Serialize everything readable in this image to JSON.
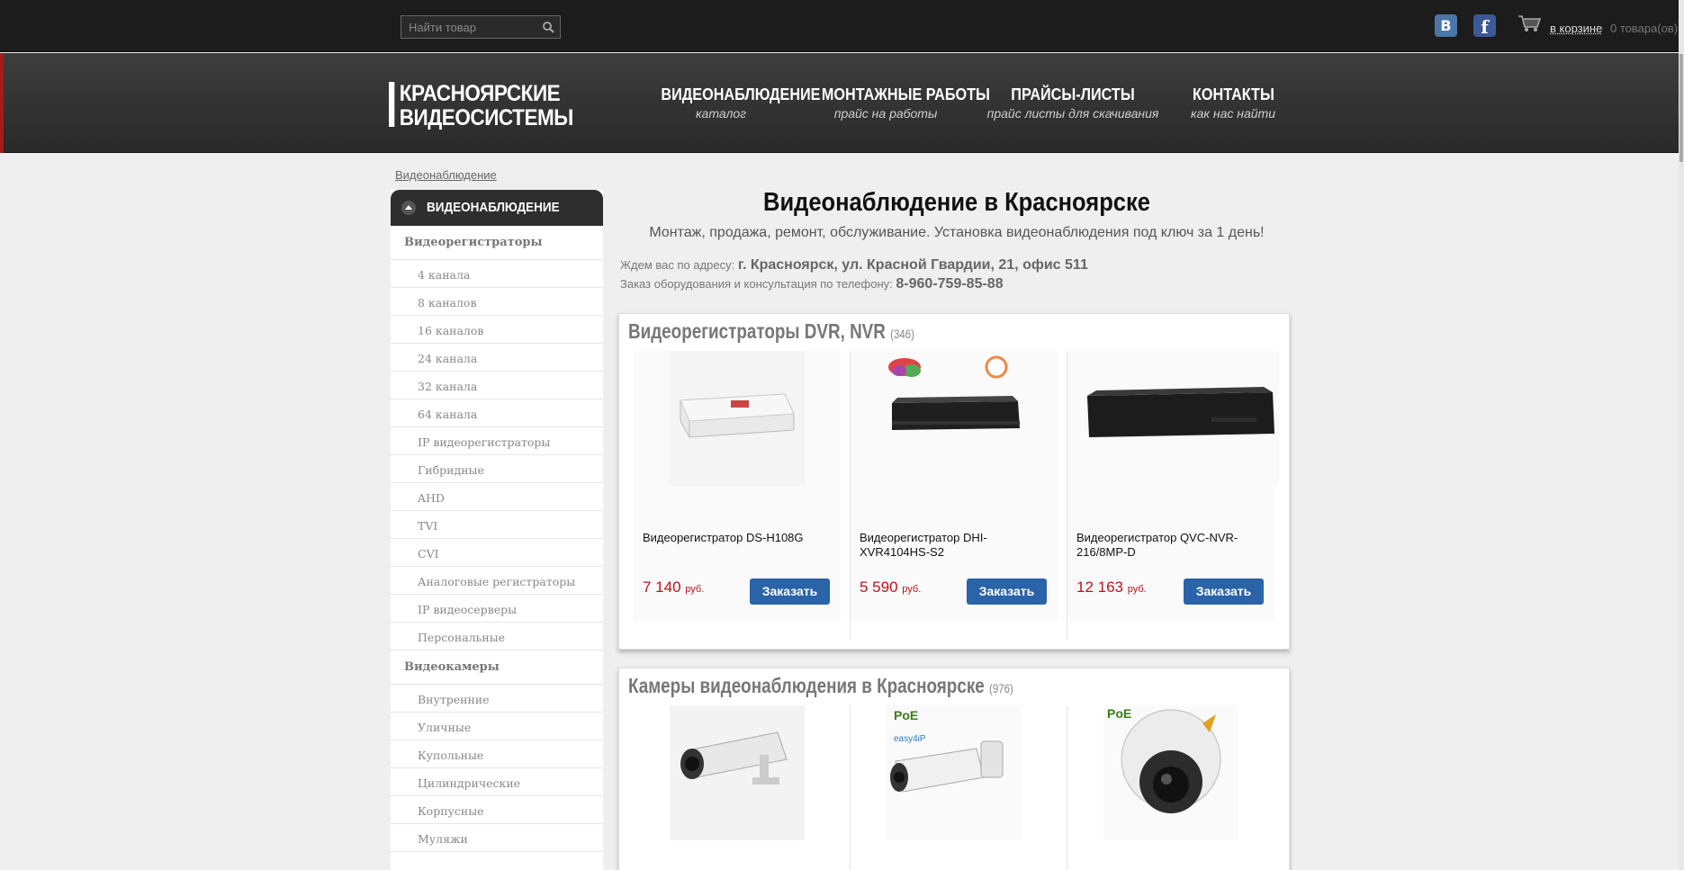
{
  "topbar": {
    "search_placeholder": "Найти товар",
    "social": [
      {
        "label": "B",
        "name": "vk-icon"
      },
      {
        "label": "f",
        "name": "facebook-icon"
      }
    ],
    "cart_link": "в корзине",
    "cart_count": "0 товара(ов)"
  },
  "header": {
    "logo_line1": "КРАСНОЯРСКИЕ",
    "logo_line2": "ВИДЕОСИСТЕМЫ",
    "nav": [
      {
        "title": "ВИДЕОНАБЛЮДЕНИЕ",
        "sub": "каталог"
      },
      {
        "title": "МОНТАЖНЫЕ РАБОТЫ",
        "sub": "прайс на работы"
      },
      {
        "title": "ПРАЙСЫ-ЛИСТЫ",
        "sub": "прайс листы для скачивания"
      },
      {
        "title": "КОНТАКТЫ",
        "sub": "как нас найти"
      }
    ]
  },
  "breadcrumb": "Видеонаблюдение",
  "sidebar": {
    "header": "ВИДЕОНАБЛЮДЕНИЕ",
    "group1": "Видеорегистраторы",
    "group1_items": [
      "4 канала",
      "8 каналов",
      "16 каналов",
      "24 канала",
      "32 канала",
      "64 канала",
      "IP видеорегистраторы",
      "Гибридные",
      "AHD",
      "TVI",
      "CVI",
      "Аналоговые регистраторы",
      "IP видеосерверы",
      "Персональные"
    ],
    "group2": "Видеокамеры",
    "group2_items": [
      "Внутренние",
      "Уличные",
      "Купольные",
      "Цилиндрические",
      "Корпусные",
      "Муляжи"
    ]
  },
  "main": {
    "title": "Видеонаблюдение в Красноярске",
    "subtitle": "Монтаж, продажа, ремонт, обслуживание. Установка видеонаблюдения под ключ за 1 день!",
    "address_label": "Ждем вас по адресу:",
    "address": "г. Красноярск, ул. Красной Гвардии, 21, офис 511",
    "phone_label": "Заказ оборудования и консультация по телефону:",
    "phone": "8-960-759-85-88"
  },
  "sections": [
    {
      "title": "Видеорегистраторы DVR, NVR",
      "count": "(346)",
      "products": [
        {
          "name": "Видеорегистратор DS-H108G",
          "price": "7 140",
          "currency": "руб.",
          "button": "Заказать"
        },
        {
          "name": "Видеорегистратор DHI-XVR4104HS-S2",
          "price": "5 590",
          "currency": "руб.",
          "button": "Заказать"
        },
        {
          "name": "Видеорегистратор QVC-NVR-216/8MP-D",
          "price": "12 163",
          "currency": "руб.",
          "button": "Заказать"
        }
      ]
    },
    {
      "title": "Камеры видеонаблюдения в Красноярске",
      "count": "(976)",
      "badges": [
        "PoE",
        "easy4ip",
        "PoE"
      ]
    }
  ],
  "colors": {
    "accent_red": "#c0131a",
    "button_blue": "#2a63a8",
    "header_dark": "#2e2e2e"
  }
}
